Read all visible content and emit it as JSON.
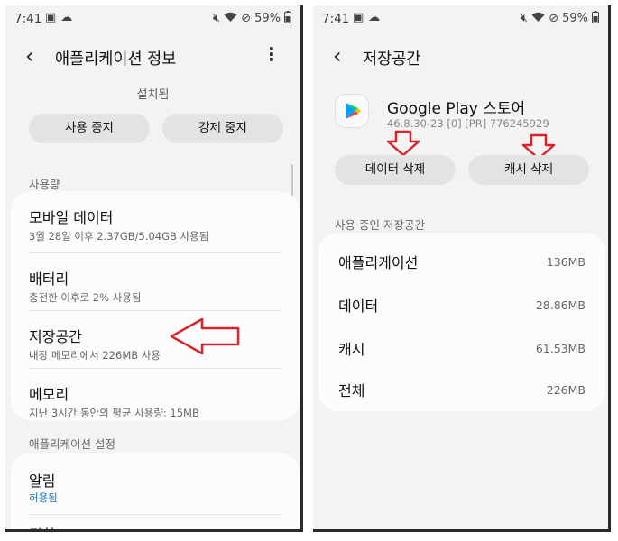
{
  "status_bar": {
    "time": "7:41",
    "battery": "59%"
  },
  "left_screen": {
    "title": "애플리케이션 정보",
    "install_status": "설치됨",
    "buttons": {
      "disable": "사용 중지",
      "force_stop": "강제 중지"
    },
    "usage_section": {
      "header": "사용량",
      "items": [
        {
          "title": "모바일 데이터",
          "subtitle": "3월 28일 이후 2.37GB/5.04GB 사용됨"
        },
        {
          "title": "배터리",
          "subtitle": "충전한 이후로 2% 사용됨"
        },
        {
          "title": "저장공간",
          "subtitle": "내장 메모리에서 226MB 사용"
        },
        {
          "title": "메모리",
          "subtitle": "지난 3시간 동안의 평균 사용량: 15MB"
        }
      ]
    },
    "settings_section": {
      "header": "애플리케이션 설정",
      "items": [
        {
          "title": "알림",
          "subtitle": "허용됨"
        },
        {
          "title": "권한"
        }
      ]
    }
  },
  "right_screen": {
    "title": "저장공간",
    "app_name": "Google Play 스토어",
    "app_version": "46.8.30-23 [0] [PR] 776245929",
    "buttons": {
      "clear_data": "데이터 삭제",
      "clear_cache": "캐시 삭제"
    },
    "storage_section": {
      "header": "사용 중인 저장공간",
      "items": [
        {
          "label": "애플리케이션",
          "value": "136MB"
        },
        {
          "label": "데이터",
          "value": "28.86MB"
        },
        {
          "label": "캐시",
          "value": "61.53MB"
        },
        {
          "label": "전체",
          "value": "226MB"
        }
      ]
    }
  },
  "icons": {
    "back": "chevron-left",
    "more": "vertical-dots",
    "app": "google-play-logo"
  },
  "colors": {
    "annotation_red": "#d9232d",
    "link_blue": "#1a6fc8",
    "background": "#f3f3f3",
    "card": "#fcfcfc",
    "pill": "#e3e3e3"
  }
}
